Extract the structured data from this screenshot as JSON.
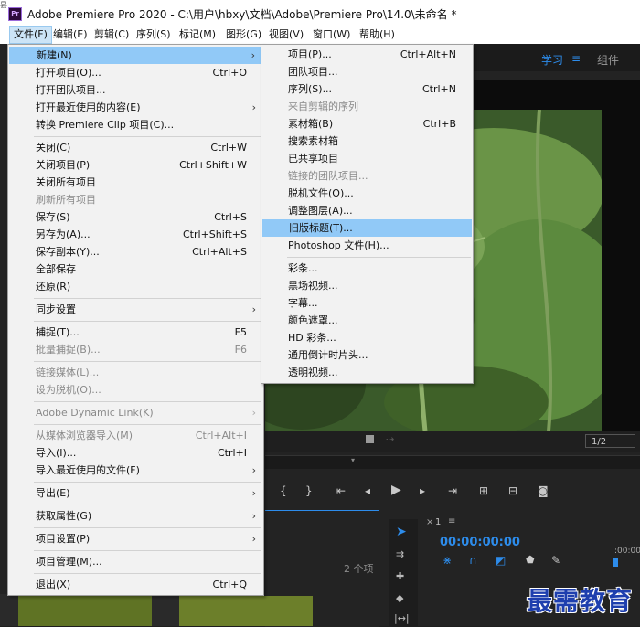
{
  "window": {
    "app_icon": "Pr",
    "title": "Adobe Premiere Pro 2020 - C:\\用户\\hbxy\\文档\\Adobe\\Premiere Pro\\14.0\\未命名 *",
    "edge_mark": "昙"
  },
  "menubar": [
    "文件(F)",
    "编辑(E)",
    "剪辑(C)",
    "序列(S)",
    "标记(M)",
    "图形(G)",
    "视图(V)",
    "窗口(W)",
    "帮助(H)"
  ],
  "workspace_tabs": [
    "学习",
    "组件"
  ],
  "file_menu": [
    {
      "label": "新建(N)",
      "shortcut": "",
      "arrow": true,
      "disabled": false,
      "highlighted": true
    },
    {
      "label": "打开项目(O)...",
      "shortcut": "Ctrl+O",
      "arrow": false,
      "disabled": false
    },
    {
      "label": "打开团队项目...",
      "shortcut": "",
      "arrow": false,
      "disabled": false
    },
    {
      "label": "打开最近使用的内容(E)",
      "shortcut": "",
      "arrow": true,
      "disabled": false
    },
    {
      "label": "转换 Premiere Clip 项目(C)...",
      "shortcut": "",
      "arrow": false,
      "disabled": false
    },
    {
      "label": "关闭(C)",
      "shortcut": "Ctrl+W",
      "arrow": false,
      "disabled": false
    },
    {
      "label": "关闭项目(P)",
      "shortcut": "Ctrl+Shift+W",
      "arrow": false,
      "disabled": false
    },
    {
      "label": "关闭所有项目",
      "shortcut": "",
      "arrow": false,
      "disabled": false
    },
    {
      "label": "刷新所有项目",
      "shortcut": "",
      "arrow": false,
      "disabled": true
    },
    {
      "label": "保存(S)",
      "shortcut": "Ctrl+S",
      "arrow": false,
      "disabled": false
    },
    {
      "label": "另存为(A)...",
      "shortcut": "Ctrl+Shift+S",
      "arrow": false,
      "disabled": false
    },
    {
      "label": "保存副本(Y)...",
      "shortcut": "Ctrl+Alt+S",
      "arrow": false,
      "disabled": false
    },
    {
      "label": "全部保存",
      "shortcut": "",
      "arrow": false,
      "disabled": false
    },
    {
      "label": "还原(R)",
      "shortcut": "",
      "arrow": false,
      "disabled": false
    },
    {
      "label": "同步设置",
      "shortcut": "",
      "arrow": true,
      "disabled": false
    },
    {
      "label": "捕捉(T)...",
      "shortcut": "F5",
      "arrow": false,
      "disabled": false
    },
    {
      "label": "批量捕捉(B)...",
      "shortcut": "F6",
      "arrow": false,
      "disabled": true
    },
    {
      "label": "链接媒体(L)...",
      "shortcut": "",
      "arrow": false,
      "disabled": true
    },
    {
      "label": "设为脱机(O)...",
      "shortcut": "",
      "arrow": false,
      "disabled": true
    },
    {
      "label": "Adobe Dynamic Link(K)",
      "shortcut": "",
      "arrow": true,
      "disabled": true
    },
    {
      "label": "从媒体浏览器导入(M)",
      "shortcut": "Ctrl+Alt+I",
      "arrow": false,
      "disabled": true
    },
    {
      "label": "导入(I)...",
      "shortcut": "Ctrl+I",
      "arrow": false,
      "disabled": false
    },
    {
      "label": "导入最近使用的文件(F)",
      "shortcut": "",
      "arrow": true,
      "disabled": false
    },
    {
      "label": "导出(E)",
      "shortcut": "",
      "arrow": true,
      "disabled": false
    },
    {
      "label": "获取属性(G)",
      "shortcut": "",
      "arrow": true,
      "disabled": false
    },
    {
      "label": "项目设置(P)",
      "shortcut": "",
      "arrow": true,
      "disabled": false
    },
    {
      "label": "项目管理(M)...",
      "shortcut": "",
      "arrow": false,
      "disabled": false
    },
    {
      "label": "退出(X)",
      "shortcut": "Ctrl+Q",
      "arrow": false,
      "disabled": false
    }
  ],
  "new_submenu": [
    {
      "label": "项目(P)...",
      "shortcut": "Ctrl+Alt+N",
      "disabled": false
    },
    {
      "label": "团队项目...",
      "shortcut": "",
      "disabled": false
    },
    {
      "label": "序列(S)...",
      "shortcut": "Ctrl+N",
      "disabled": false
    },
    {
      "label": "来自剪辑的序列",
      "shortcut": "",
      "disabled": true
    },
    {
      "label": "素材箱(B)",
      "shortcut": "Ctrl+B",
      "disabled": false
    },
    {
      "label": "搜索素材箱",
      "shortcut": "",
      "disabled": false
    },
    {
      "label": "已共享项目",
      "shortcut": "",
      "disabled": false
    },
    {
      "label": "链接的团队项目...",
      "shortcut": "",
      "disabled": true
    },
    {
      "label": "脱机文件(O)...",
      "shortcut": "",
      "disabled": false
    },
    {
      "label": "调整图层(A)...",
      "shortcut": "",
      "disabled": false
    },
    {
      "label": "旧版标题(T)...",
      "shortcut": "",
      "disabled": false,
      "highlighted": true
    },
    {
      "label": "Photoshop 文件(H)...",
      "shortcut": "",
      "disabled": false
    },
    {
      "label": "彩条...",
      "shortcut": "",
      "disabled": false
    },
    {
      "label": "黑场视频...",
      "shortcut": "",
      "disabled": false
    },
    {
      "label": "字幕...",
      "shortcut": "",
      "disabled": false
    },
    {
      "label": "颜色遮罩...",
      "shortcut": "",
      "disabled": false
    },
    {
      "label": "HD 彩条...",
      "shortcut": "",
      "disabled": false
    },
    {
      "label": "通用倒计时片头...",
      "shortcut": "",
      "disabled": false
    },
    {
      "label": "透明视频...",
      "shortcut": "",
      "disabled": false
    }
  ],
  "monitor": {
    "resolution": "1/2"
  },
  "project_panel": {
    "item_count": "2 个项"
  },
  "sequence": {
    "tab_label": "1",
    "timecode": "00:00:00:00",
    "ruler_start": ":00:00"
  },
  "watermark": "最需教育",
  "colors": {
    "accent": "#2d8ceb",
    "menu_highlight": "#91c9f7",
    "menu_bg": "#f2f2f2"
  }
}
